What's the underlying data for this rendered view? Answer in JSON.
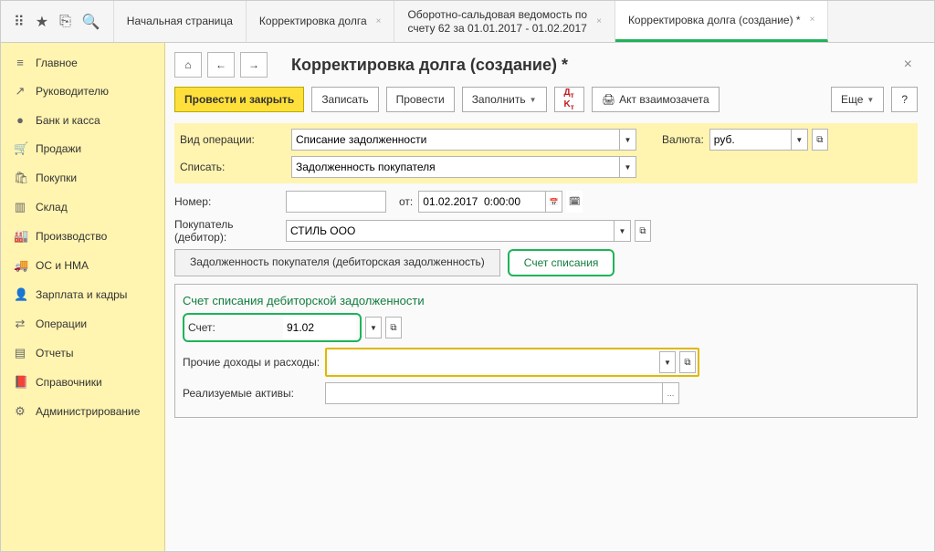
{
  "topIcons": {
    "apps": "⠿",
    "star": "★",
    "files": "⎘",
    "search": "🔍"
  },
  "tabs": [
    {
      "label": "Начальная страница",
      "closable": false
    },
    {
      "label": "Корректировка долга",
      "closable": true
    },
    {
      "label": "Оборотно-сальдовая ведомость по\nсчету 62 за 01.01.2017 - 01.02.2017",
      "closable": true
    },
    {
      "label": "Корректировка долга (создание) *",
      "closable": true,
      "active": true
    }
  ],
  "sidebar": [
    {
      "icon": "≡",
      "label": "Главное"
    },
    {
      "icon": "↗",
      "label": "Руководителю"
    },
    {
      "icon": "●",
      "label": "Банк и касса"
    },
    {
      "icon": "🛒",
      "label": "Продажи"
    },
    {
      "icon": "🛍",
      "label": "Покупки"
    },
    {
      "icon": "▥",
      "label": "Склад"
    },
    {
      "icon": "🏭",
      "label": "Производство"
    },
    {
      "icon": "🚚",
      "label": "ОС и НМА"
    },
    {
      "icon": "👤",
      "label": "Зарплата и кадры"
    },
    {
      "icon": "⇄",
      "label": "Операции"
    },
    {
      "icon": "▤",
      "label": "Отчеты"
    },
    {
      "icon": "📕",
      "label": "Справочники"
    },
    {
      "icon": "⚙",
      "label": "Администрирование"
    }
  ],
  "nav": {
    "home": "⌂",
    "back": "←",
    "fwd": "→"
  },
  "pageTitle": "Корректировка долга (создание) *",
  "toolbar": {
    "primary": "Провести и закрыть",
    "save": "Записать",
    "post": "Провести",
    "fill": "Заполнить",
    "dkicon": "Дт Кт",
    "act": "Акт взаимозачета",
    "print": "🖨",
    "more": "Еще",
    "help": "?"
  },
  "form": {
    "opType": {
      "label": "Вид операции:",
      "value": "Списание задолженности"
    },
    "write": {
      "label": "Списать:",
      "value": "Задолженность покупателя"
    },
    "number": {
      "label": "Номер:"
    },
    "from": {
      "label": "от:",
      "value": "01.02.2017  0:00:00"
    },
    "buyer": {
      "label": "Покупатель (дебитор):",
      "value": "СТИЛЬ ООО"
    },
    "currency": {
      "label": "Валюта:",
      "value": "руб."
    }
  },
  "subTabs": {
    "debt": "Задолженность покупателя (дебиторская задолженность)",
    "account": "Счет списания"
  },
  "section": {
    "title": "Счет списания дебиторской задолженности",
    "account": {
      "label": "Счет:",
      "value": "91.02"
    },
    "other": {
      "label": "Прочие доходы и расходы:"
    },
    "assets": {
      "label": "Реализуемые активы:"
    }
  }
}
